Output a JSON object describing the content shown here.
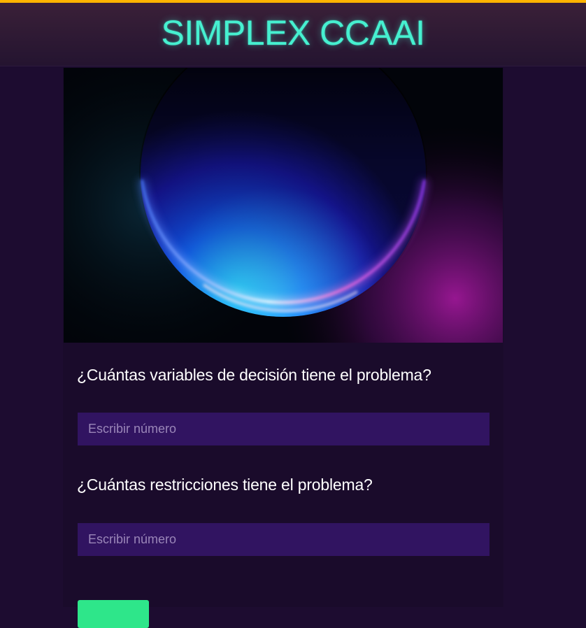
{
  "header": {
    "title": "SIMPLEX CCAAI",
    "title_color": "#46f0d0",
    "accent_color": "#ffb400"
  },
  "hero": {
    "image_name": "glowing-sphere-image"
  },
  "form": {
    "variables_question": "¿Cuántas variables de decisión tiene el problema?",
    "variables_placeholder": "Escribir número",
    "variables_value": "",
    "constraints_question": "¿Cuántas restricciones tiene el problema?",
    "constraints_placeholder": "Escribir número",
    "constraints_value": "",
    "submit_label": "",
    "submit_color": "#2ee68a"
  }
}
